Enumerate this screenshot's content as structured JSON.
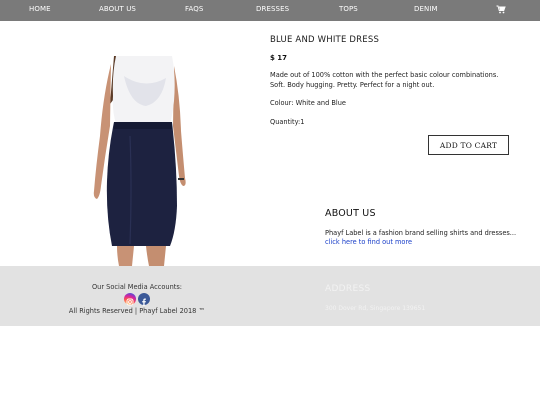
{
  "nav": {
    "items": [
      {
        "label": "HOME"
      },
      {
        "label": "ABOUT US"
      },
      {
        "label": "FAQS"
      },
      {
        "label": "DRESSES"
      },
      {
        "label": "TOPS"
      },
      {
        "label": "DENIM"
      }
    ],
    "cart_icon": "shopping-cart-icon"
  },
  "product": {
    "title": "BLUE AND WHITE DRESS",
    "price": "$ 17",
    "description": "Made out of 100% cotton with the perfect basic colour combinations. Soft. Body hugging. Pretty. Perfect for a night out.",
    "colour": "Colour: White and Blue",
    "quantity": "Quantity:1",
    "add_to_cart": "ADD TO CART"
  },
  "about": {
    "heading": "ABOUT US",
    "text": "Phayf Label is a fashion brand selling shirts and dresses...",
    "link": "click here to find out more"
  },
  "footer": {
    "social_label": "Our Social Media Accounts:",
    "social_icons": [
      "instagram-icon",
      "facebook-icon"
    ],
    "rights": "All Rights Reserved | Phayf Label 2018 ™",
    "address_heading": "ADDRESS",
    "address_text": "300 Dover Rd, Singapore 139651"
  },
  "colors": {
    "nav_bg": "#7a7a7a",
    "footer_bg": "#d7d7d7",
    "link": "#1a3fc9",
    "dress": "#1d2240"
  }
}
